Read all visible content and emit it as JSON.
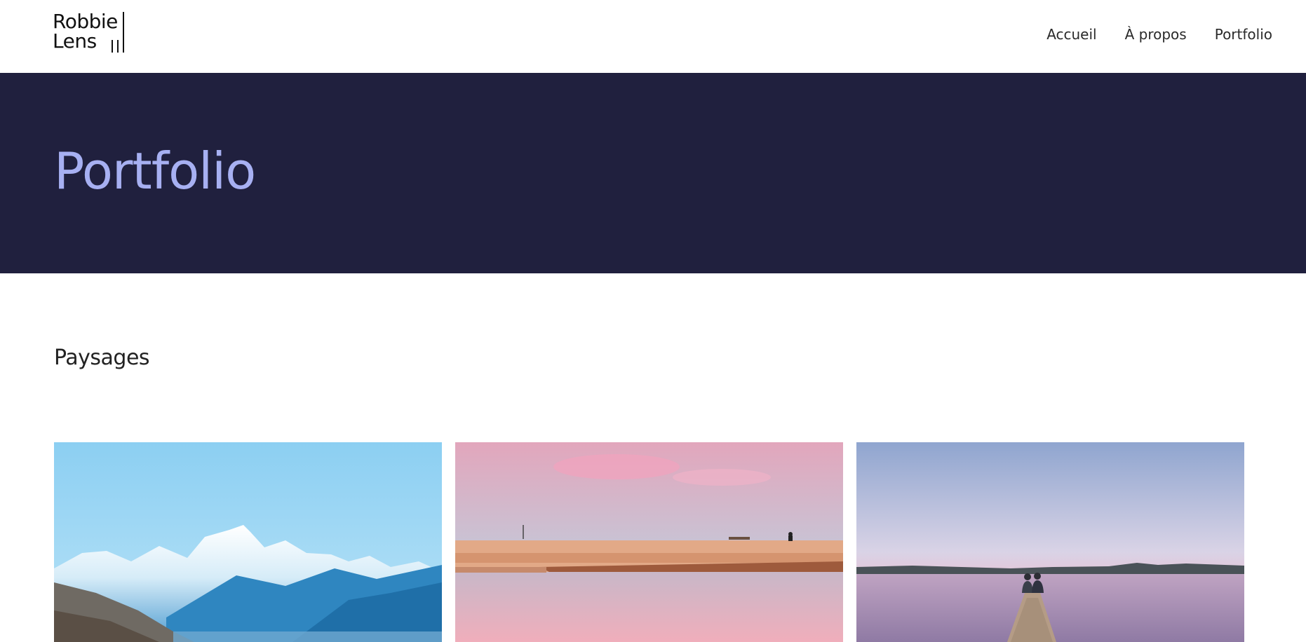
{
  "logo": {
    "line1": "Robbie",
    "line2": "Lens"
  },
  "nav": {
    "items": [
      "Accueil",
      "À propos",
      "Portfolio"
    ]
  },
  "hero": {
    "title": "Portfolio",
    "background": "#20203e",
    "title_color": "#a7b0f2"
  },
  "section": {
    "title": "Paysages"
  },
  "gallery": {
    "images": [
      {
        "subject": "mountain-lake"
      },
      {
        "subject": "sunset-beach"
      },
      {
        "subject": "couple-on-jetty"
      }
    ]
  }
}
